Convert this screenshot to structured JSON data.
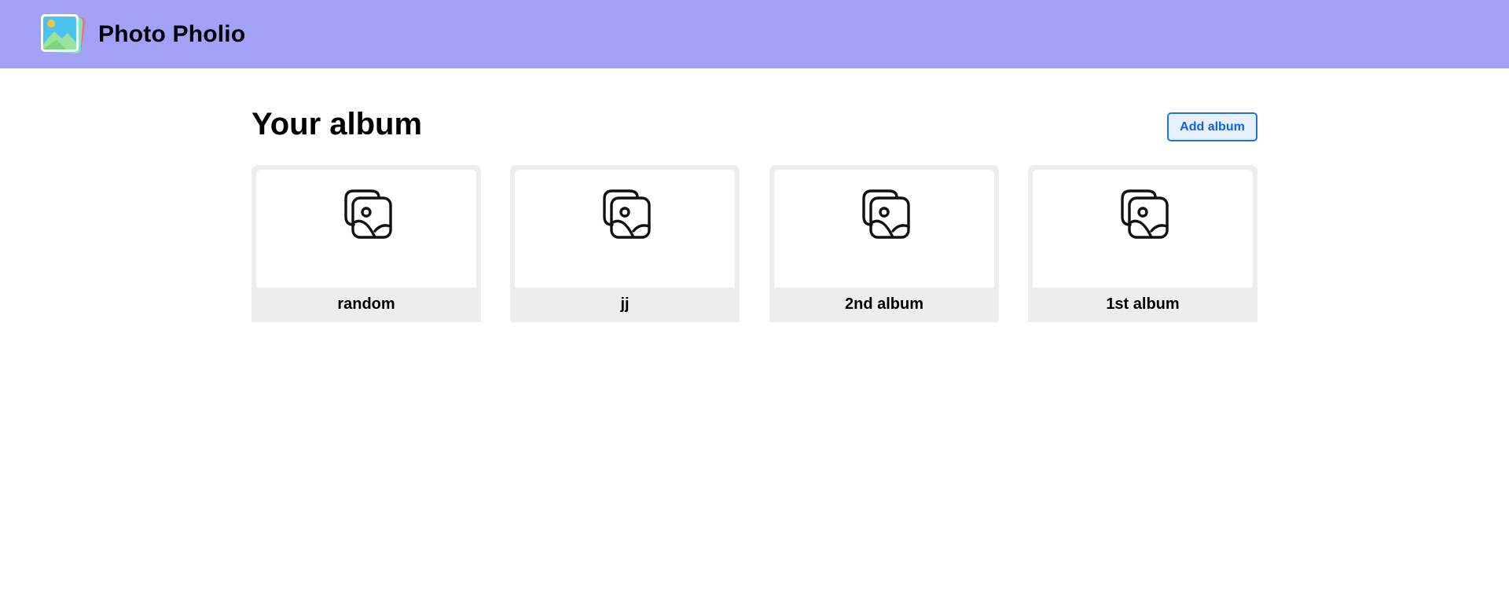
{
  "navbar": {
    "brand": "Photo Pholio",
    "logo_icon": "photo-stack-logo-icon"
  },
  "page": {
    "title": "Your album",
    "add_button_label": "Add album"
  },
  "albums": [
    {
      "name": "random",
      "icon": "photo-album-icon"
    },
    {
      "name": "jj",
      "icon": "photo-album-icon"
    },
    {
      "name": "2nd album",
      "icon": "photo-album-icon"
    },
    {
      "name": "1st album",
      "icon": "photo-album-icon"
    }
  ],
  "colors": {
    "navbar_bg": "#a1a1f8",
    "card_bg": "#ededed",
    "accent": "#1a73e8"
  }
}
